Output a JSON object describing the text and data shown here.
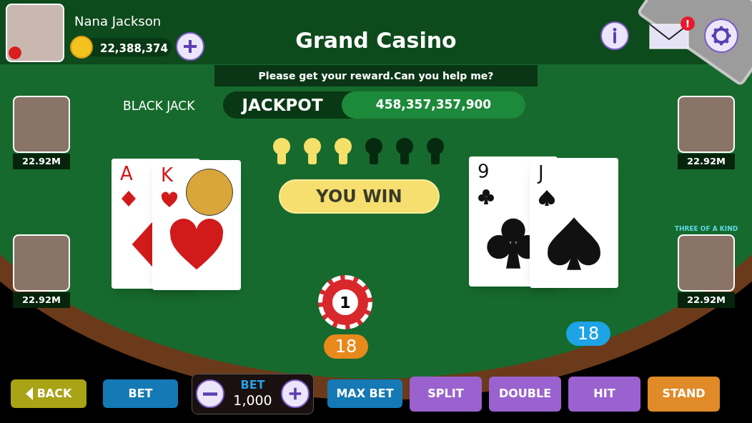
{
  "player": {
    "name": "Nana Jackson",
    "coins": "22,388,374"
  },
  "title": "Grand Casino",
  "mail": {
    "badge": "!"
  },
  "message": "Please get your reward.Can you help me?",
  "game_label": "BLACK JACK",
  "jackpot": {
    "label": "JACKPOT",
    "amount": "458,357,357,900"
  },
  "bulbs": [
    {
      "on": true
    },
    {
      "on": true
    },
    {
      "on": true
    },
    {
      "on": false
    },
    {
      "on": false
    },
    {
      "on": false
    }
  ],
  "result": "YOU WIN",
  "seats": [
    {
      "balance": "22.92M"
    },
    {
      "balance": "22.92M"
    },
    {
      "balance": "22.92M"
    },
    {
      "balance": "22.92M",
      "caption": "THREE OF A KIND"
    }
  ],
  "hands": [
    {
      "cards": [
        {
          "rank": "A",
          "kind": "diamonds"
        },
        {
          "rank": "K",
          "kind": "hearts"
        }
      ],
      "score": "18",
      "color": "#e8891c"
    },
    {
      "cards": [
        {
          "rank": "9",
          "kind": "clubs"
        },
        {
          "rank": "J",
          "kind": "spades"
        }
      ],
      "score": "18",
      "color": "#1ea3e6"
    }
  ],
  "chip": "1",
  "bet": {
    "label": "BET",
    "value": "1,000"
  },
  "buttons": [
    {
      "label": "BACK",
      "kind": "back",
      "color": "#a9a316"
    },
    {
      "label": "BET",
      "kind": "plain",
      "color": "#1479b5"
    },
    {
      "kind": "bet_control"
    },
    {
      "label": "MAX BET",
      "kind": "plain",
      "color": "#1479b5"
    },
    {
      "label": "SPLIT",
      "kind": "plain",
      "color": "#9a62cf"
    },
    {
      "label": "DOUBLE",
      "kind": "plain",
      "color": "#9a62cf"
    },
    {
      "label": "HIT",
      "kind": "plain",
      "color": "#9a62cf"
    },
    {
      "label": "STAND",
      "kind": "plain",
      "color": "#e08a28"
    }
  ]
}
